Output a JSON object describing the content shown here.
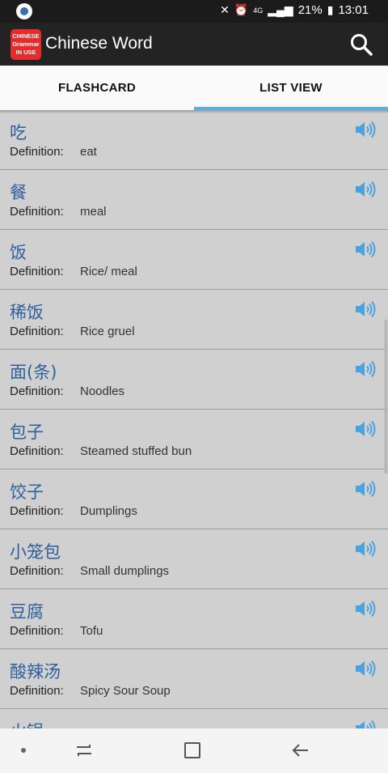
{
  "status_bar": {
    "icons": [
      "mute-icon",
      "alarm-icon",
      "4g-icon",
      "signal-icon",
      "battery-icon"
    ],
    "network": "4G",
    "battery": "21%",
    "time": "13:01"
  },
  "app_bar": {
    "logo_lines": [
      "CHINESE",
      "Grammar",
      "IN USE"
    ],
    "title": "Chinese Word",
    "search_icon": "search-icon"
  },
  "tabs": [
    {
      "label": "FLASHCARD",
      "active": false
    },
    {
      "label": "LIST VIEW",
      "active": true
    }
  ],
  "words": [
    {
      "word": "吃",
      "label": "Definition:",
      "definition": "eat"
    },
    {
      "word": "餐",
      "label": "Definition:",
      "definition": "meal"
    },
    {
      "word": "饭",
      "label": "Definition:",
      "definition": "Rice/ meal"
    },
    {
      "word": "稀饭",
      "label": "Definition:",
      "definition": "Rice gruel"
    },
    {
      "word": "面(条)",
      "label": "Definition:",
      "definition": "Noodles"
    },
    {
      "word": "包子",
      "label": "Definition:",
      "definition": "Steamed stuffed bun"
    },
    {
      "word": " 饺子",
      "label": "Definition:",
      "definition": "Dumplings"
    },
    {
      "word": "小笼包",
      "label": "Definition:",
      "definition": "Small dumplings"
    },
    {
      "word": "豆腐",
      "label": "Definition:",
      "definition": "Tofu"
    },
    {
      "word": "酸辣汤",
      "label": "Definition:",
      "definition": "Spicy Sour Soup"
    },
    {
      "word": "火锅",
      "label": "Definition:",
      "definition": ""
    }
  ],
  "colors": {
    "accent": "#5aaee0",
    "word_color": "#2f5f9c",
    "speaker_color": "#4aa3df",
    "logo_red": "#e52b2b"
  },
  "nav_bar": {
    "icons": [
      "dot-icon",
      "recent-apps-icon",
      "home-icon",
      "back-icon"
    ]
  }
}
